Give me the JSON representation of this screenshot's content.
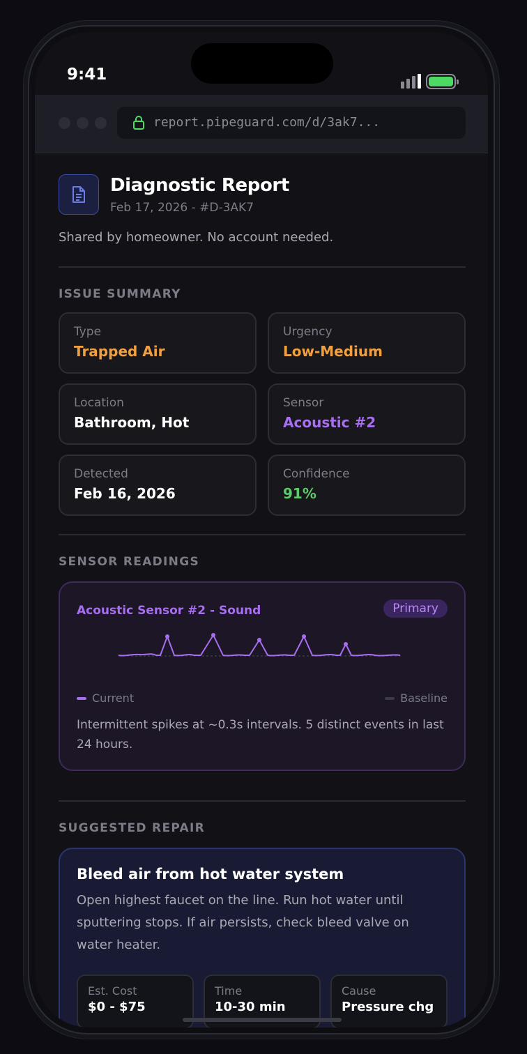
{
  "status_bar": {
    "time": "9:41"
  },
  "browser": {
    "url": "report.pipeguard.com/d/3ak7..."
  },
  "report": {
    "title": "Diagnostic Report",
    "subtitle": "Feb 17, 2026 - #D-3AK7",
    "shared_note": "Shared by homeowner. No account needed."
  },
  "issue_summary": {
    "heading": "ISSUE SUMMARY",
    "items": [
      {
        "label": "Type",
        "value": "Trapped Air",
        "color": "#f0a040"
      },
      {
        "label": "Urgency",
        "value": "Low-Medium",
        "color": "#f0a040"
      },
      {
        "label": "Location",
        "value": "Bathroom, Hot",
        "color": "#ffffff"
      },
      {
        "label": "Sensor",
        "value": "Acoustic #2",
        "color": "#a86ef0"
      },
      {
        "label": "Detected",
        "value": "Feb 16, 2026",
        "color": "#ffffff"
      },
      {
        "label": "Confidence",
        "value": "91%",
        "color": "#5ecb6a"
      }
    ]
  },
  "sensor_readings": {
    "heading": "SENSOR READINGS",
    "sensor_name": "Acoustic Sensor #2 - Sound",
    "badge": "Primary",
    "legend_current": "Current",
    "legend_baseline": "Baseline",
    "current_color": "#a86ef0",
    "baseline_color": "#3a3b44",
    "description": "Intermittent spikes at ~0.3s intervals. 5 distinct events in last 24 hours."
  },
  "suggested_repair": {
    "heading": "SUGGESTED REPAIR",
    "title": "Bleed air from hot water system",
    "description": "Open highest faucet on the line. Run hot water until sputtering stops. If air persists, check bleed valve on water heater.",
    "stats": [
      {
        "label": "Est. Cost",
        "value": "$0 - $75"
      },
      {
        "label": "Time",
        "value": "10-30 min"
      },
      {
        "label": "Cause",
        "value": "Pressure chg"
      }
    ]
  }
}
